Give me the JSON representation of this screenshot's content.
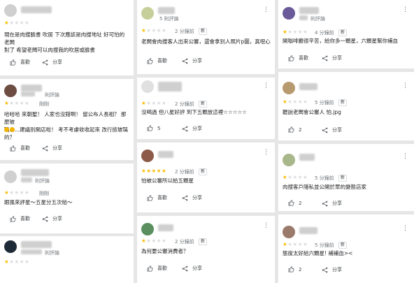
{
  "reviews": [
    {
      "reviewer_sub": "",
      "time": "",
      "new_badge": "",
      "stars": 1,
      "text": "現在是肉搜臉書 吹居 下次應該是肉搜地址 好可怕的老闆\n對了 希望老闆可以肉搜我的吹居或臉書",
      "like_label": "喜歡",
      "like_count": "",
      "share_label": "分享"
    },
    {
      "reviewer_sub": "則評論",
      "time": "剛剛",
      "new_badge": "",
      "stars": 1,
      "text": "哈哈哈 來朝聖！ 人家也沒錯啊！ 留公布人長相？ 那麼玻\n璃心...建議別開店啦！ 考不考慮收收起來 改行撿玻璃的？",
      "like_label": "喜歡",
      "like_count": "",
      "share_label": "分享"
    },
    {
      "reviewer_sub": "則評論",
      "time": "剛剛",
      "new_badge": "",
      "stars": 1,
      "text": "跟風來評星～五星分五次給～",
      "like_label": "喜歡",
      "like_count": "",
      "share_label": "分享"
    },
    {
      "reviewer_sub": "則評論",
      "time": "",
      "new_badge": "",
      "stars": 1,
      "text": "",
      "like_label": "",
      "like_count": "",
      "share_label": ""
    },
    {
      "reviewer_sub": "5 則評論",
      "time": "2 分鐘前",
      "new_badge": "新",
      "stars": 1,
      "text": "老闆會肉搜客人出來公審，還會拿別人照片p圖，真噁心",
      "like_label": "喜歡",
      "like_count": "",
      "share_label": "分享"
    },
    {
      "reviewer_sub": "",
      "time": "2 分鐘前",
      "new_badge": "新",
      "stars": 1,
      "text": "沒喝過 但八星好評 到下五顆放這裡☆☆☆☆☆",
      "like_label": "",
      "like_count": "5",
      "share_label": "分享"
    },
    {
      "reviewer_sub": "",
      "time": "2 分鐘前",
      "new_badge": "新",
      "stars": 5,
      "text": "怕被公審所以給五顆星",
      "like_label": "喜歡",
      "like_count": "",
      "share_label": "分享"
    },
    {
      "reviewer_sub": "",
      "time": "2 分鐘前",
      "new_badge": "新",
      "stars": 1,
      "text": "為何要公審消費者？",
      "like_label": "喜歡",
      "like_count": "",
      "share_label": "分享"
    },
    {
      "reviewer_sub": "則評論",
      "time": "4 分鐘前",
      "new_badge": "新",
      "stars": 1,
      "text": "開咖啡廳很辛苦，給你多一顆星，六顆星幫你補血",
      "like_label": "喜歡",
      "like_count": "",
      "share_label": "分享"
    },
    {
      "reviewer_sub": "",
      "time": "5 分鐘前",
      "new_badge": "新",
      "stars": 1,
      "text": "聽說老闆會公審人 怕.jpg",
      "like_label": "",
      "like_count": "2",
      "share_label": "分享"
    },
    {
      "reviewer_sub": "",
      "time": "5 分鐘前",
      "new_badge": "新",
      "stars": 1,
      "text": "肉搜客戶隱私並公開於眾的變態店家",
      "like_label": "",
      "like_count": "2",
      "share_label": "分享"
    },
    {
      "reviewer_sub": "",
      "time": "5 分鐘前",
      "new_badge": "新",
      "stars": 1,
      "text": "態度太好給六顆星! 補補血><",
      "like_label": "",
      "like_count": "2",
      "share_label": "分享"
    }
  ],
  "colors": {
    "star_on": "#fbbc04",
    "star_off": "#dadce0"
  }
}
